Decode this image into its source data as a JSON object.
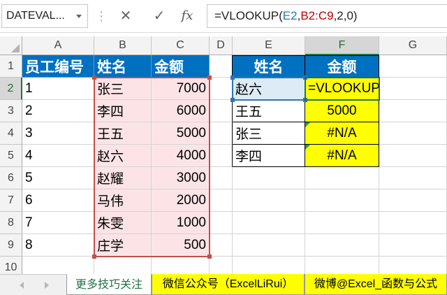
{
  "name_box": {
    "value": "DATEVAL...",
    "dropdown_icon": "chevron-down-icon"
  },
  "formula_bar": {
    "icons": {
      "separator": "vertical-dots-icon",
      "cancel": "close-icon",
      "enter": "check-icon",
      "insert_function": "fx-icon"
    },
    "cancel_glyph": "✕",
    "enter_glyph": "✓",
    "fx_label": "fx",
    "formula": {
      "prefix": "=VLOOKUP(",
      "ref1": "E2",
      "sep": ",",
      "ref2": "B2:C9",
      "suffix": ",2,0)"
    }
  },
  "columns": [
    "A",
    "B",
    "C",
    "D",
    "E",
    "F",
    "G"
  ],
  "rows": [
    "1",
    "2",
    "3",
    "4",
    "5",
    "6",
    "7",
    "8",
    "9",
    "10"
  ],
  "table1": {
    "headers": [
      "员工编号",
      "姓名",
      "金额"
    ],
    "rows": [
      [
        "1",
        "张三",
        "7000"
      ],
      [
        "2",
        "李四",
        "6000"
      ],
      [
        "3",
        "王五",
        "5000"
      ],
      [
        "4",
        "赵六",
        "4000"
      ],
      [
        "5",
        "赵耀",
        "3000"
      ],
      [
        "6",
        "马伟",
        "2000"
      ],
      [
        "7",
        "朱雯",
        "1000"
      ],
      [
        "8",
        "庄学",
        "500"
      ]
    ]
  },
  "table2": {
    "headers": [
      "姓名",
      "金额"
    ],
    "rows": [
      [
        "赵六",
        "=VLOOKUP"
      ],
      [
        "王五",
        "5000"
      ],
      [
        "张三",
        "#N/A"
      ],
      [
        "李四",
        "#N/A"
      ]
    ]
  },
  "sheet_tabs": [
    {
      "label": "更多技巧关注",
      "active": true
    },
    {
      "label": "微信公众号（ExcelLiRui）",
      "active": false
    },
    {
      "label": "微博@Excel_函数与公式",
      "active": false
    }
  ],
  "tab_nav": {
    "prev_icon": "triangle-left-icon",
    "next_icon": "triangle-right-icon"
  },
  "colors": {
    "header_fill": "#0070C0",
    "yellow_fill": "#FFFF00",
    "range_red": "#C0504D",
    "range_red_fill": "#FCE4E6",
    "ref_blue": "#2F75B5",
    "ref_blue_fill": "#DDEBF7",
    "accent": "#217346"
  }
}
